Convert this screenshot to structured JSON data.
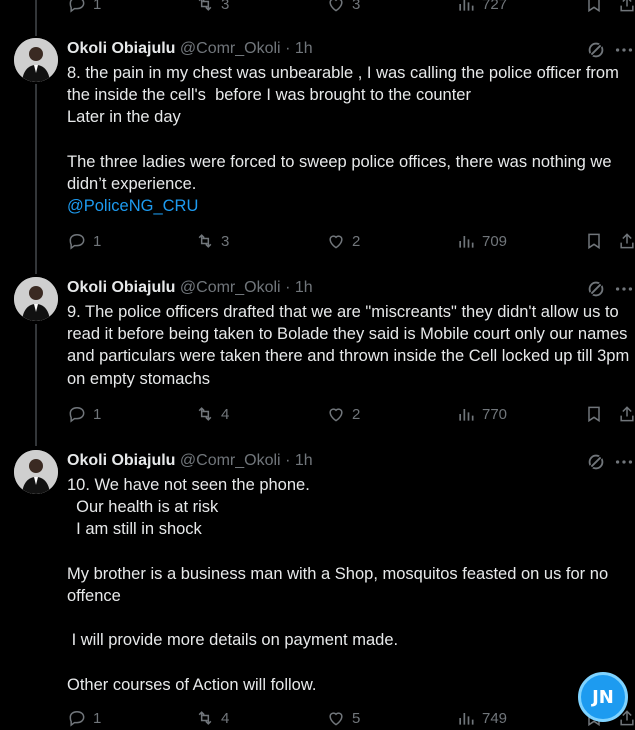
{
  "top_actions": {
    "replies": "1",
    "reposts": "3",
    "likes": "3",
    "views": "727"
  },
  "tweets": [
    {
      "author": "Okoli Obiajulu",
      "handle": "@Comr_Okoli",
      "time": "· 1h",
      "text": "8. the pain in my chest was unbearable , I was calling the police officer from the inside the cell's  before I was brought to the counter\nLater in the day\n\nThe three ladies were forced to sweep police offices, there was nothing we didn’t experience.",
      "mention": "@PoliceNG_CRU",
      "replies": "1",
      "reposts": "3",
      "likes": "2",
      "views": "709"
    },
    {
      "author": "Okoli Obiajulu",
      "handle": "@Comr_Okoli",
      "time": "· 1h",
      "text": "9. The police officers drafted that we are \"miscreants\" they didn't allow us to read it before being taken to Bolade they said is Mobile court only our names and particulars were taken there and thrown inside the Cell locked up till 3pm on empty stomachs",
      "replies": "1",
      "reposts": "4",
      "likes": "2",
      "views": "770"
    },
    {
      "author": "Okoli Obiajulu",
      "handle": "@Comr_Okoli",
      "time": "· 1h",
      "text": "10. We have not seen the phone.\n  Our health is at risk\n  I am still in shock\n\nMy brother is a business man with a Shop, mosquitos feasted on us for no offence\n\n I will provide more details on payment made.\n\nOther courses of Action will follow.",
      "replies": "1",
      "reposts": "4",
      "likes": "5",
      "views": "749"
    }
  ],
  "watermark": {
    "text": "JN"
  },
  "colors": {
    "background": "#000000",
    "text": "#e7e9ea",
    "muted": "#71767b",
    "link": "#1d9bf0"
  }
}
